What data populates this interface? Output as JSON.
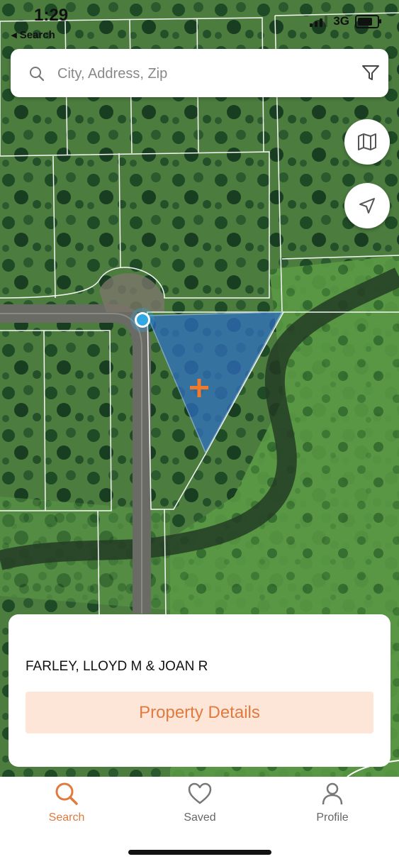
{
  "status": {
    "time": "1:29",
    "back_label": "◂ Search",
    "network": "3G"
  },
  "search": {
    "placeholder": "City, Address, Zip"
  },
  "map": {
    "layer_icon": "map-icon",
    "locate_icon": "navigation-arrow-icon",
    "parcel_highlight_color": "#2f6fc0",
    "marker_color": "#f07a2a",
    "location_dot_color": "#31a8e6"
  },
  "card": {
    "owner_name": "FARLEY, LLOYD M & JOAN R",
    "details_button": "Property Details",
    "accent_color": "#e07a3e"
  },
  "tabs": [
    {
      "label": "Search",
      "icon": "search-icon",
      "active": true
    },
    {
      "label": "Saved",
      "icon": "heart-icon",
      "active": false
    },
    {
      "label": "Profile",
      "icon": "person-icon",
      "active": false
    }
  ]
}
